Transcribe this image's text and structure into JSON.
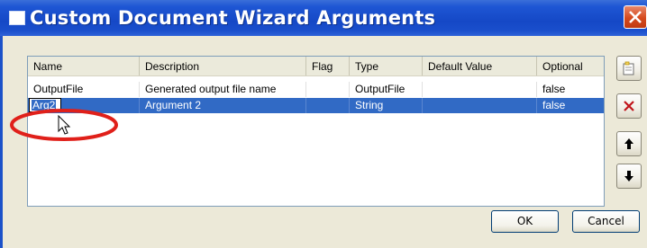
{
  "window": {
    "title": "Custom Document Wizard Arguments"
  },
  "table": {
    "columns": [
      "Name",
      "Description",
      "Flag",
      "Type",
      "Default Value",
      "Optional"
    ],
    "rows": [
      {
        "name": "OutputFile",
        "description": "Generated output file name",
        "flag": "",
        "type": "OutputFile",
        "default_value": "",
        "optional": "false",
        "selected": false
      },
      {
        "name": "Arg2",
        "description": "Argument 2",
        "flag": "",
        "type": "String",
        "default_value": "",
        "optional": "false",
        "selected": true
      }
    ]
  },
  "buttons": {
    "ok": "OK",
    "cancel": "Cancel"
  },
  "side_buttons": [
    "new-argument-icon",
    "delete-icon",
    "arrow-up-icon",
    "arrow-down-icon"
  ],
  "colors": {
    "selection": "#316ac5",
    "annotation": "#e0201a",
    "titlebar": "#1548c6"
  }
}
